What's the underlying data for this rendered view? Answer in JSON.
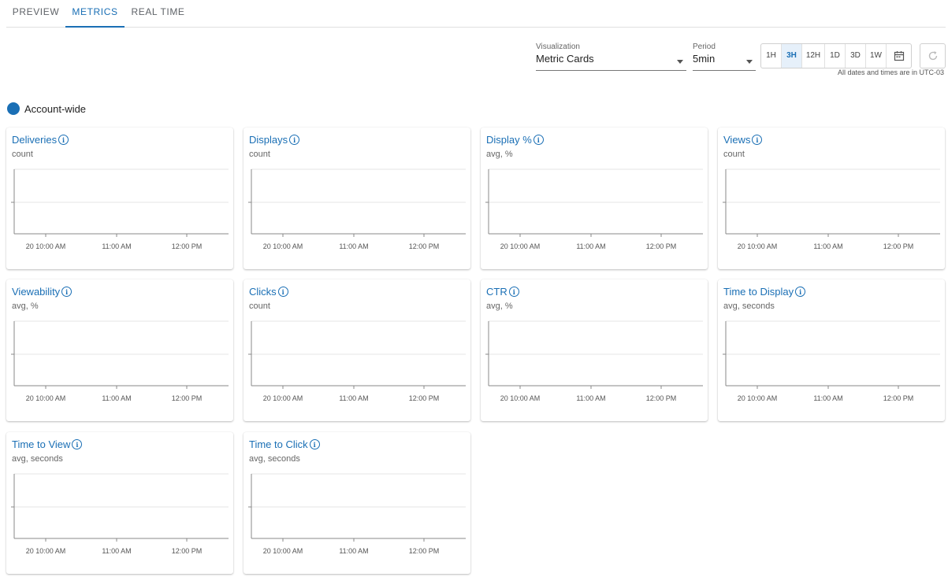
{
  "tabs": [
    {
      "label": "PREVIEW",
      "active": false
    },
    {
      "label": "METRICS",
      "active": true
    },
    {
      "label": "REAL TIME",
      "active": false
    }
  ],
  "controls": {
    "visualization": {
      "label": "Visualization",
      "value": "Metric Cards"
    },
    "period": {
      "label": "Period",
      "value": "5min"
    },
    "ranges": [
      "1H",
      "3H",
      "12H",
      "1D",
      "3D",
      "1W"
    ],
    "active_range": "3H",
    "calendar_icon": "calendar-icon",
    "refresh_icon": "refresh-icon",
    "timezone_note": "All dates and times are in UTC-03"
  },
  "account": {
    "label": "Account-wide",
    "color": "#1a6fb5"
  },
  "x_ticks": [
    "20 10:00 AM",
    "11:00 AM",
    "12:00 PM"
  ],
  "cards": [
    {
      "title": "Deliveries",
      "subtitle": "count"
    },
    {
      "title": "Displays",
      "subtitle": "count"
    },
    {
      "title": "Display %",
      "subtitle": "avg, %"
    },
    {
      "title": "Views",
      "subtitle": "count"
    },
    {
      "title": "Viewability",
      "subtitle": "avg, %"
    },
    {
      "title": "Clicks",
      "subtitle": "count"
    },
    {
      "title": "CTR",
      "subtitle": "avg, %"
    },
    {
      "title": "Time to Display",
      "subtitle": "avg, seconds"
    },
    {
      "title": "Time to View",
      "subtitle": "avg, seconds"
    },
    {
      "title": "Time to Click",
      "subtitle": "avg, seconds"
    }
  ],
  "info_glyph": "i"
}
